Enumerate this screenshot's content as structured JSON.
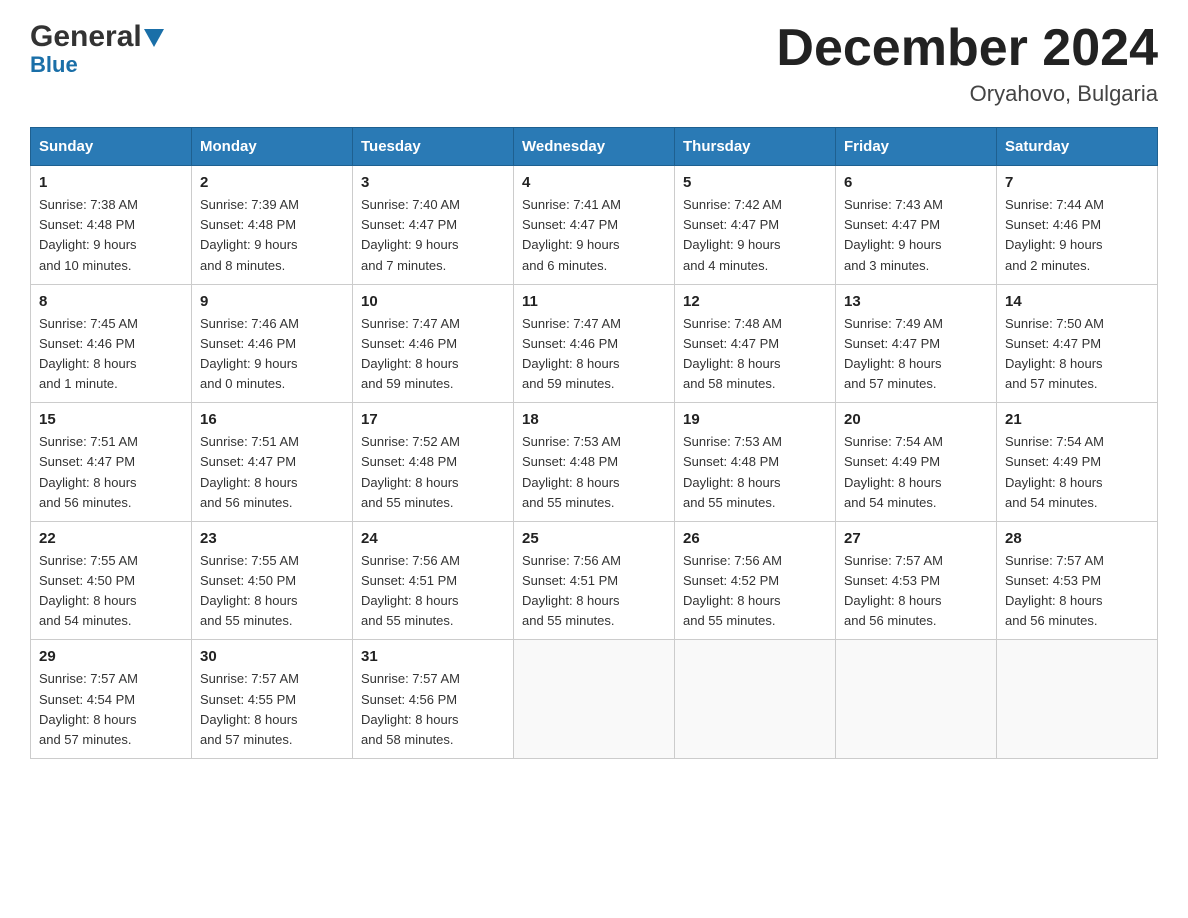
{
  "logo": {
    "general": "General",
    "blue": "Blue"
  },
  "title": "December 2024",
  "subtitle": "Oryahovo, Bulgaria",
  "days_header": [
    "Sunday",
    "Monday",
    "Tuesday",
    "Wednesday",
    "Thursday",
    "Friday",
    "Saturday"
  ],
  "weeks": [
    [
      {
        "day": "1",
        "sunrise": "7:38 AM",
        "sunset": "4:48 PM",
        "daylight": "9 hours and 10 minutes."
      },
      {
        "day": "2",
        "sunrise": "7:39 AM",
        "sunset": "4:48 PM",
        "daylight": "9 hours and 8 minutes."
      },
      {
        "day": "3",
        "sunrise": "7:40 AM",
        "sunset": "4:47 PM",
        "daylight": "9 hours and 7 minutes."
      },
      {
        "day": "4",
        "sunrise": "7:41 AM",
        "sunset": "4:47 PM",
        "daylight": "9 hours and 6 minutes."
      },
      {
        "day": "5",
        "sunrise": "7:42 AM",
        "sunset": "4:47 PM",
        "daylight": "9 hours and 4 minutes."
      },
      {
        "day": "6",
        "sunrise": "7:43 AM",
        "sunset": "4:47 PM",
        "daylight": "9 hours and 3 minutes."
      },
      {
        "day": "7",
        "sunrise": "7:44 AM",
        "sunset": "4:46 PM",
        "daylight": "9 hours and 2 minutes."
      }
    ],
    [
      {
        "day": "8",
        "sunrise": "7:45 AM",
        "sunset": "4:46 PM",
        "daylight": "8 hours and 1 minute."
      },
      {
        "day": "9",
        "sunrise": "7:46 AM",
        "sunset": "4:46 PM",
        "daylight": "9 hours and 0 minutes."
      },
      {
        "day": "10",
        "sunrise": "7:47 AM",
        "sunset": "4:46 PM",
        "daylight": "8 hours and 59 minutes."
      },
      {
        "day": "11",
        "sunrise": "7:47 AM",
        "sunset": "4:46 PM",
        "daylight": "8 hours and 59 minutes."
      },
      {
        "day": "12",
        "sunrise": "7:48 AM",
        "sunset": "4:47 PM",
        "daylight": "8 hours and 58 minutes."
      },
      {
        "day": "13",
        "sunrise": "7:49 AM",
        "sunset": "4:47 PM",
        "daylight": "8 hours and 57 minutes."
      },
      {
        "day": "14",
        "sunrise": "7:50 AM",
        "sunset": "4:47 PM",
        "daylight": "8 hours and 57 minutes."
      }
    ],
    [
      {
        "day": "15",
        "sunrise": "7:51 AM",
        "sunset": "4:47 PM",
        "daylight": "8 hours and 56 minutes."
      },
      {
        "day": "16",
        "sunrise": "7:51 AM",
        "sunset": "4:47 PM",
        "daylight": "8 hours and 56 minutes."
      },
      {
        "day": "17",
        "sunrise": "7:52 AM",
        "sunset": "4:48 PM",
        "daylight": "8 hours and 55 minutes."
      },
      {
        "day": "18",
        "sunrise": "7:53 AM",
        "sunset": "4:48 PM",
        "daylight": "8 hours and 55 minutes."
      },
      {
        "day": "19",
        "sunrise": "7:53 AM",
        "sunset": "4:48 PM",
        "daylight": "8 hours and 55 minutes."
      },
      {
        "day": "20",
        "sunrise": "7:54 AM",
        "sunset": "4:49 PM",
        "daylight": "8 hours and 54 minutes."
      },
      {
        "day": "21",
        "sunrise": "7:54 AM",
        "sunset": "4:49 PM",
        "daylight": "8 hours and 54 minutes."
      }
    ],
    [
      {
        "day": "22",
        "sunrise": "7:55 AM",
        "sunset": "4:50 PM",
        "daylight": "8 hours and 54 minutes."
      },
      {
        "day": "23",
        "sunrise": "7:55 AM",
        "sunset": "4:50 PM",
        "daylight": "8 hours and 55 minutes."
      },
      {
        "day": "24",
        "sunrise": "7:56 AM",
        "sunset": "4:51 PM",
        "daylight": "8 hours and 55 minutes."
      },
      {
        "day": "25",
        "sunrise": "7:56 AM",
        "sunset": "4:51 PM",
        "daylight": "8 hours and 55 minutes."
      },
      {
        "day": "26",
        "sunrise": "7:56 AM",
        "sunset": "4:52 PM",
        "daylight": "8 hours and 55 minutes."
      },
      {
        "day": "27",
        "sunrise": "7:57 AM",
        "sunset": "4:53 PM",
        "daylight": "8 hours and 56 minutes."
      },
      {
        "day": "28",
        "sunrise": "7:57 AM",
        "sunset": "4:53 PM",
        "daylight": "8 hours and 56 minutes."
      }
    ],
    [
      {
        "day": "29",
        "sunrise": "7:57 AM",
        "sunset": "4:54 PM",
        "daylight": "8 hours and 57 minutes."
      },
      {
        "day": "30",
        "sunrise": "7:57 AM",
        "sunset": "4:55 PM",
        "daylight": "8 hours and 57 minutes."
      },
      {
        "day": "31",
        "sunrise": "7:57 AM",
        "sunset": "4:56 PM",
        "daylight": "8 hours and 58 minutes."
      },
      null,
      null,
      null,
      null
    ]
  ],
  "labels": {
    "sunrise": "Sunrise:",
    "sunset": "Sunset:",
    "daylight": "Daylight:"
  }
}
